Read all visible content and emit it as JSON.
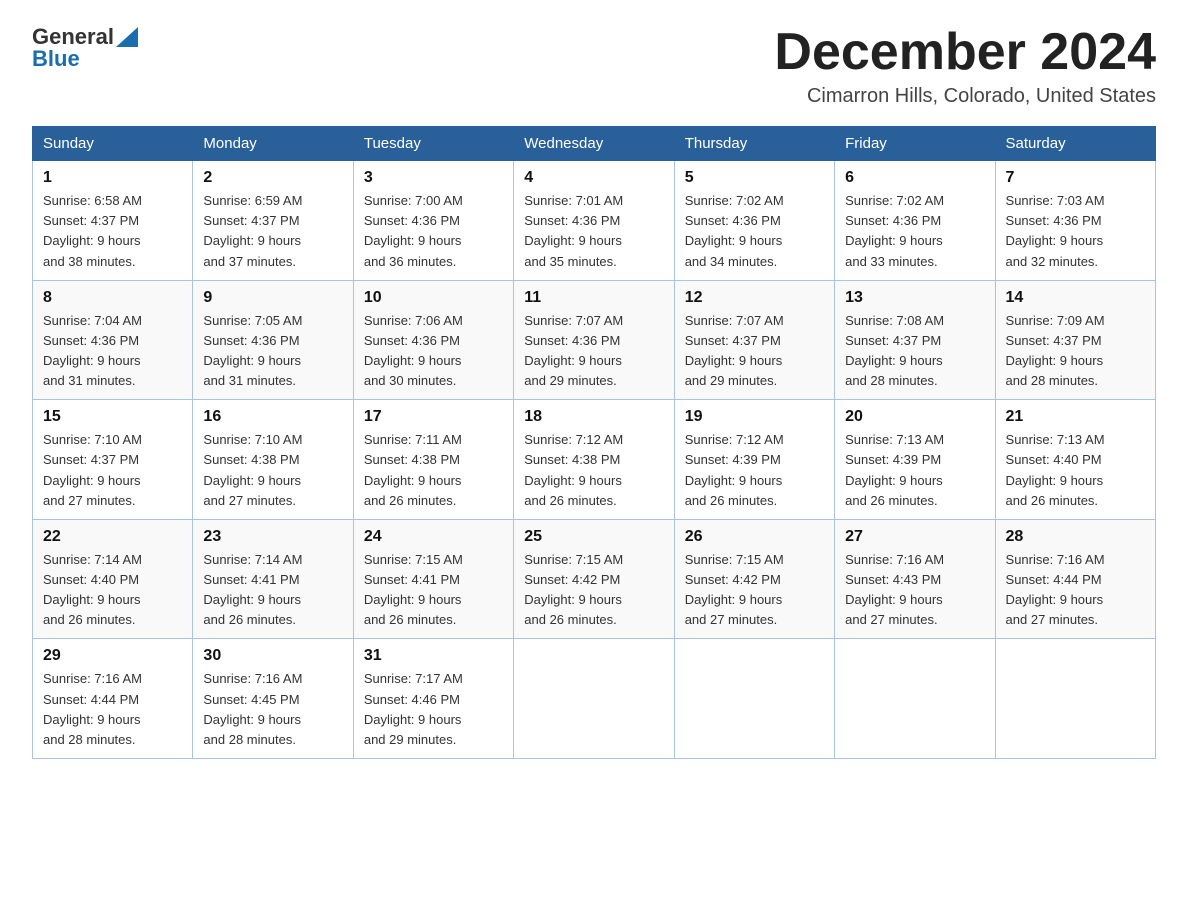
{
  "logo": {
    "general": "General",
    "blue": "Blue"
  },
  "title": "December 2024",
  "location": "Cimarron Hills, Colorado, United States",
  "days_of_week": [
    "Sunday",
    "Monday",
    "Tuesday",
    "Wednesday",
    "Thursday",
    "Friday",
    "Saturday"
  ],
  "weeks": [
    [
      {
        "day": "1",
        "sunrise": "6:58 AM",
        "sunset": "4:37 PM",
        "daylight": "9 hours and 38 minutes."
      },
      {
        "day": "2",
        "sunrise": "6:59 AM",
        "sunset": "4:37 PM",
        "daylight": "9 hours and 37 minutes."
      },
      {
        "day": "3",
        "sunrise": "7:00 AM",
        "sunset": "4:36 PM",
        "daylight": "9 hours and 36 minutes."
      },
      {
        "day": "4",
        "sunrise": "7:01 AM",
        "sunset": "4:36 PM",
        "daylight": "9 hours and 35 minutes."
      },
      {
        "day": "5",
        "sunrise": "7:02 AM",
        "sunset": "4:36 PM",
        "daylight": "9 hours and 34 minutes."
      },
      {
        "day": "6",
        "sunrise": "7:02 AM",
        "sunset": "4:36 PM",
        "daylight": "9 hours and 33 minutes."
      },
      {
        "day": "7",
        "sunrise": "7:03 AM",
        "sunset": "4:36 PM",
        "daylight": "9 hours and 32 minutes."
      }
    ],
    [
      {
        "day": "8",
        "sunrise": "7:04 AM",
        "sunset": "4:36 PM",
        "daylight": "9 hours and 31 minutes."
      },
      {
        "day": "9",
        "sunrise": "7:05 AM",
        "sunset": "4:36 PM",
        "daylight": "9 hours and 31 minutes."
      },
      {
        "day": "10",
        "sunrise": "7:06 AM",
        "sunset": "4:36 PM",
        "daylight": "9 hours and 30 minutes."
      },
      {
        "day": "11",
        "sunrise": "7:07 AM",
        "sunset": "4:36 PM",
        "daylight": "9 hours and 29 minutes."
      },
      {
        "day": "12",
        "sunrise": "7:07 AM",
        "sunset": "4:37 PM",
        "daylight": "9 hours and 29 minutes."
      },
      {
        "day": "13",
        "sunrise": "7:08 AM",
        "sunset": "4:37 PM",
        "daylight": "9 hours and 28 minutes."
      },
      {
        "day": "14",
        "sunrise": "7:09 AM",
        "sunset": "4:37 PM",
        "daylight": "9 hours and 28 minutes."
      }
    ],
    [
      {
        "day": "15",
        "sunrise": "7:10 AM",
        "sunset": "4:37 PM",
        "daylight": "9 hours and 27 minutes."
      },
      {
        "day": "16",
        "sunrise": "7:10 AM",
        "sunset": "4:38 PM",
        "daylight": "9 hours and 27 minutes."
      },
      {
        "day": "17",
        "sunrise": "7:11 AM",
        "sunset": "4:38 PM",
        "daylight": "9 hours and 26 minutes."
      },
      {
        "day": "18",
        "sunrise": "7:12 AM",
        "sunset": "4:38 PM",
        "daylight": "9 hours and 26 minutes."
      },
      {
        "day": "19",
        "sunrise": "7:12 AM",
        "sunset": "4:39 PM",
        "daylight": "9 hours and 26 minutes."
      },
      {
        "day": "20",
        "sunrise": "7:13 AM",
        "sunset": "4:39 PM",
        "daylight": "9 hours and 26 minutes."
      },
      {
        "day": "21",
        "sunrise": "7:13 AM",
        "sunset": "4:40 PM",
        "daylight": "9 hours and 26 minutes."
      }
    ],
    [
      {
        "day": "22",
        "sunrise": "7:14 AM",
        "sunset": "4:40 PM",
        "daylight": "9 hours and 26 minutes."
      },
      {
        "day": "23",
        "sunrise": "7:14 AM",
        "sunset": "4:41 PM",
        "daylight": "9 hours and 26 minutes."
      },
      {
        "day": "24",
        "sunrise": "7:15 AM",
        "sunset": "4:41 PM",
        "daylight": "9 hours and 26 minutes."
      },
      {
        "day": "25",
        "sunrise": "7:15 AM",
        "sunset": "4:42 PM",
        "daylight": "9 hours and 26 minutes."
      },
      {
        "day": "26",
        "sunrise": "7:15 AM",
        "sunset": "4:42 PM",
        "daylight": "9 hours and 27 minutes."
      },
      {
        "day": "27",
        "sunrise": "7:16 AM",
        "sunset": "4:43 PM",
        "daylight": "9 hours and 27 minutes."
      },
      {
        "day": "28",
        "sunrise": "7:16 AM",
        "sunset": "4:44 PM",
        "daylight": "9 hours and 27 minutes."
      }
    ],
    [
      {
        "day": "29",
        "sunrise": "7:16 AM",
        "sunset": "4:44 PM",
        "daylight": "9 hours and 28 minutes."
      },
      {
        "day": "30",
        "sunrise": "7:16 AM",
        "sunset": "4:45 PM",
        "daylight": "9 hours and 28 minutes."
      },
      {
        "day": "31",
        "sunrise": "7:17 AM",
        "sunset": "4:46 PM",
        "daylight": "9 hours and 29 minutes."
      },
      null,
      null,
      null,
      null
    ]
  ],
  "labels": {
    "sunrise": "Sunrise:",
    "sunset": "Sunset:",
    "daylight": "Daylight:"
  }
}
